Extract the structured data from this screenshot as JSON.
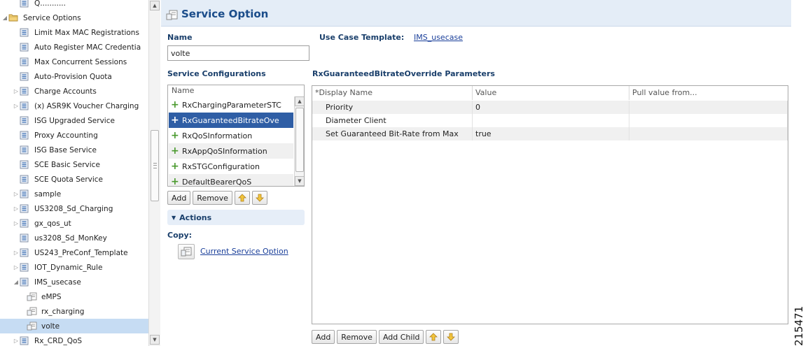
{
  "tree": {
    "items": [
      {
        "label": "Q...........",
        "arrow": "",
        "icon": "node-icon",
        "level": 1,
        "selected": false
      },
      {
        "label": "Service Options",
        "arrow": "expanded",
        "icon": "folder-icon",
        "level": 0,
        "selected": false
      },
      {
        "label": "Limit Max MAC Registrations",
        "arrow": "",
        "icon": "node-icon",
        "level": 1,
        "selected": false
      },
      {
        "label": "Auto Register MAC Credentia",
        "arrow": "",
        "icon": "node-icon",
        "level": 1,
        "selected": false
      },
      {
        "label": "Max Concurrent Sessions",
        "arrow": "",
        "icon": "node-icon",
        "level": 1,
        "selected": false
      },
      {
        "label": "Auto-Provision Quota",
        "arrow": "",
        "icon": "node-icon",
        "level": 1,
        "selected": false
      },
      {
        "label": "Charge Accounts",
        "arrow": "collapsed",
        "icon": "node-icon",
        "level": 1,
        "selected": false
      },
      {
        "label": "(x) ASR9K Voucher Charging",
        "arrow": "collapsed",
        "icon": "node-icon",
        "level": 1,
        "selected": false
      },
      {
        "label": "ISG Upgraded Service",
        "arrow": "",
        "icon": "node-icon",
        "level": 1,
        "selected": false
      },
      {
        "label": "Proxy Accounting",
        "arrow": "",
        "icon": "node-icon",
        "level": 1,
        "selected": false
      },
      {
        "label": "ISG Base Service",
        "arrow": "",
        "icon": "node-icon",
        "level": 1,
        "selected": false
      },
      {
        "label": "SCE Basic Service",
        "arrow": "",
        "icon": "node-icon",
        "level": 1,
        "selected": false
      },
      {
        "label": "SCE Quota Service",
        "arrow": "",
        "icon": "node-icon",
        "level": 1,
        "selected": false
      },
      {
        "label": "sample",
        "arrow": "collapsed",
        "icon": "node-icon",
        "level": 1,
        "selected": false
      },
      {
        "label": "US3208_Sd_Charging",
        "arrow": "collapsed",
        "icon": "node-icon",
        "level": 1,
        "selected": false
      },
      {
        "label": "gx_qos_ut",
        "arrow": "collapsed",
        "icon": "node-icon",
        "level": 1,
        "selected": false
      },
      {
        "label": "us3208_Sd_MonKey",
        "arrow": "",
        "icon": "node-icon",
        "level": 1,
        "selected": false
      },
      {
        "label": "US243_PreConf_Template",
        "arrow": "collapsed",
        "icon": "node-icon",
        "level": 1,
        "selected": false
      },
      {
        "label": "IOT_Dynamic_Rule",
        "arrow": "collapsed",
        "icon": "node-icon",
        "level": 1,
        "selected": false
      },
      {
        "label": "IMS_usecase",
        "arrow": "expanded",
        "icon": "node-icon",
        "level": 1,
        "selected": false
      },
      {
        "label": "eMPS",
        "arrow": "",
        "icon": "option-icon",
        "level": 2,
        "selected": false
      },
      {
        "label": "rx_charging",
        "arrow": "",
        "icon": "option-icon",
        "level": 2,
        "selected": false
      },
      {
        "label": "volte",
        "arrow": "",
        "icon": "option-icon",
        "level": 2,
        "selected": true
      },
      {
        "label": "Rx_CRD_QoS",
        "arrow": "collapsed",
        "icon": "node-icon",
        "level": 1,
        "selected": false
      }
    ]
  },
  "header": {
    "title": "Service Option"
  },
  "form": {
    "name_label": "Name",
    "name_value": "volte",
    "use_case_label": "Use Case Template:",
    "use_case_link": "IMS_usecase",
    "service_configs_label": "Service Configurations",
    "params_label": "RxGuaranteedBitrateOverride Parameters"
  },
  "configs": {
    "column": "Name",
    "items": [
      {
        "label": "RxChargingParameterSTC",
        "selected": false
      },
      {
        "label": "RxGuaranteedBitrateOve",
        "selected": true
      },
      {
        "label": "RxQoSInformation",
        "selected": false
      },
      {
        "label": "RxAppQoSInformation",
        "selected": false
      },
      {
        "label": "RxSTGConfiguration",
        "selected": false
      },
      {
        "label": "DefaultBearerQoS",
        "selected": false
      }
    ],
    "buttons": {
      "add": "Add",
      "remove": "Remove"
    }
  },
  "actions": {
    "title": "Actions",
    "copy_label": "Copy:",
    "current_link": "Current Service Option"
  },
  "params": {
    "columns": [
      "*Display Name",
      "Value",
      "Pull value from..."
    ],
    "rows": [
      [
        "Priority",
        "0",
        ""
      ],
      [
        "Diameter Client",
        "",
        ""
      ],
      [
        "Set Guaranteed Bit-Rate from Max",
        "true",
        ""
      ]
    ],
    "buttons": {
      "add": "Add",
      "remove": "Remove",
      "add_child": "Add Child"
    }
  },
  "watermark": "215471",
  "colors": {
    "accent": "#1a4c8a",
    "selected_row": "#2f5ea5",
    "tree_selected": "#c6dcf3",
    "header_bg": "#e4edf7"
  }
}
